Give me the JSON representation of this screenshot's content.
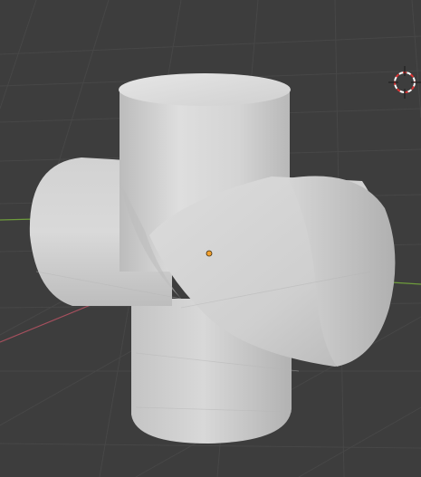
{
  "app": {
    "type": "3d-viewport",
    "background_color": "#3d3d3d",
    "grid_color": "#4a4a4a",
    "x_axis_color": "#a7505e",
    "y_axis_color": "#6e9c3c",
    "object_color": "#d6d6d6",
    "origin_color": "#f2a12f"
  },
  "scene": {
    "object": "cross-pipe-mesh",
    "origin_icon": "object-origin-dot",
    "cursor_icon": "3d-cursor-icon"
  }
}
